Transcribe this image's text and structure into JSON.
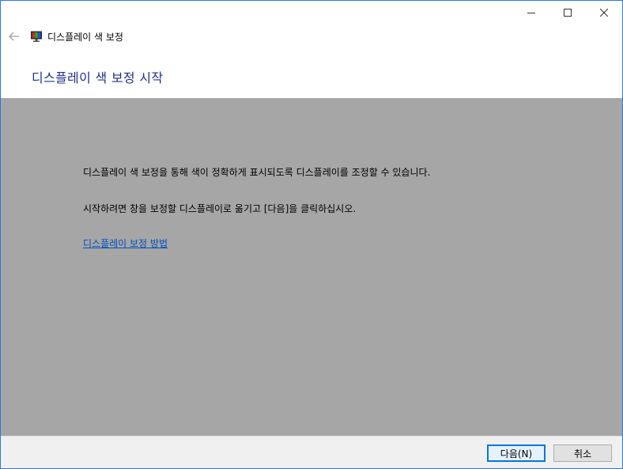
{
  "window": {
    "title": "디스플레이 색 보정"
  },
  "header": {
    "title": "디스플레이 색 보정 시작"
  },
  "content": {
    "paragraph1": "디스플레이 색 보정을 통해 색이 정확하게 표시되도록 디스플레이를 조정할 수 있습니다.",
    "paragraph2": "시작하려면 창을 보정할 디스플레이로 옮기고 [다음]을 클릭하십시오.",
    "help_link": "디스플레이 보정 방법"
  },
  "footer": {
    "next_label": "다음(N)",
    "cancel_label": "취소"
  },
  "icons": {
    "back": "back-arrow-icon",
    "app": "display-calibration-icon",
    "minimize": "minimize-icon",
    "maximize": "maximize-icon",
    "close": "close-icon"
  },
  "colors": {
    "title_text": "#1e3287",
    "content_bg": "#a6a6a6",
    "link": "#0050bd",
    "accent": "#0078d7"
  }
}
